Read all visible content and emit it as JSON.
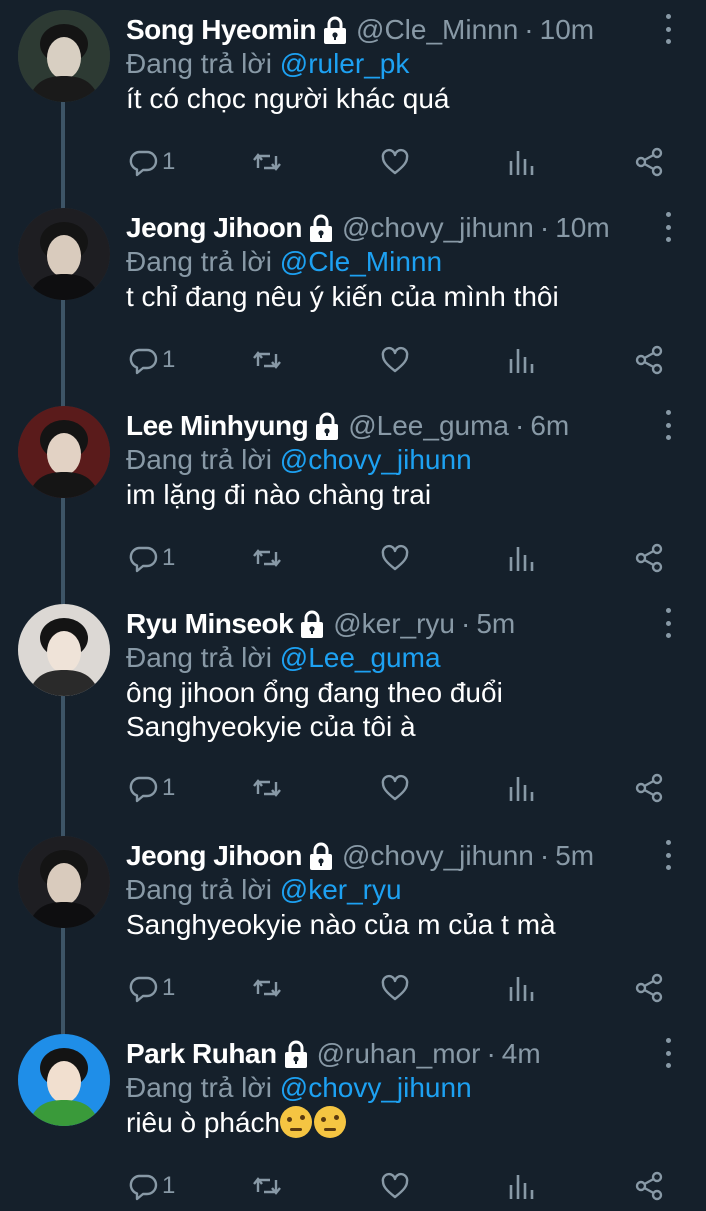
{
  "reply_prefix": "Đang trả lời",
  "tweets": [
    {
      "name": "Song Hyeomin",
      "handle": "@Cle_Minnn",
      "time": "10m",
      "reply_to": "@ruler_pk",
      "line1": "ít có chọc người khác quá",
      "line2": "",
      "reply_count": "1",
      "avatar_colors": [
        "#2d3a33",
        "#d8cfc2",
        "#1a1a1a"
      ]
    },
    {
      "name": "Jeong Jihoon",
      "handle": "@chovy_jihunn",
      "time": "10m",
      "reply_to": "@Cle_Minnn",
      "line1": "t chỉ đang nêu ý kiến của mình thôi",
      "line2": "",
      "reply_count": "1",
      "avatar_colors": [
        "#1e1e22",
        "#d9cbbd",
        "#0e0e10"
      ]
    },
    {
      "name": "Lee Minhyung",
      "handle": "@Lee_guma",
      "time": "6m",
      "reply_to": "@chovy_jihunn",
      "line1": "im lặng đi nào chàng trai",
      "line2": "",
      "reply_count": "1",
      "avatar_colors": [
        "#5a1b1b",
        "#e2d2c4",
        "#151515"
      ]
    },
    {
      "name": "Ryu Minseok",
      "handle": "@ker_ryu",
      "time": "5m",
      "reply_to": "@Lee_guma",
      "line1": "ông jihoon ổng đang theo đuổi",
      "line2": "Sanghyeokyie của tôi à",
      "reply_count": "1",
      "avatar_colors": [
        "#dcd8d4",
        "#efe3d8",
        "#2a2a2a"
      ]
    },
    {
      "name": "Jeong Jihoon",
      "handle": "@chovy_jihunn",
      "time": "5m",
      "reply_to": "@ker_ryu",
      "line1": "Sanghyeokyie nào của m của t mà",
      "line2": "",
      "reply_count": "1",
      "avatar_colors": [
        "#1e1e22",
        "#d9cbbd",
        "#0e0e10"
      ]
    },
    {
      "name": "Park Ruhan",
      "handle": "@ruhan_mor",
      "time": "4m",
      "reply_to": "@chovy_jihunn",
      "line1": "riêu ò phách",
      "line2": "",
      "reply_count": "1",
      "avatar_colors": [
        "#1f8ee8",
        "#f1dfcf",
        "#3a9a3a"
      ]
    }
  ],
  "colors": {
    "background": "#15202b",
    "text": "#ffffff",
    "muted": "#8899a6",
    "link": "#1da1f2",
    "thread_line": "#3d5466"
  },
  "icons": [
    "lock-icon",
    "more-icon",
    "reply-icon",
    "retweet-icon",
    "like-icon",
    "analytics-icon",
    "share-icon",
    "thinking-emoji"
  ]
}
